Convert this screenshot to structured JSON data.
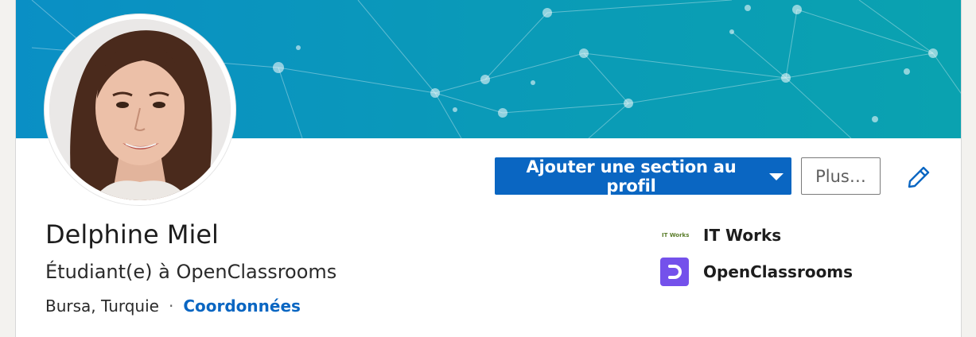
{
  "profile": {
    "name": "Delphine Miel",
    "headline": "Étudiant(e) à OpenClassrooms",
    "location": "Bursa, Turquie",
    "separator": "·",
    "contact_label": "Coordonnées"
  },
  "actions": {
    "add_section_label": "Ajouter une section au profil",
    "more_label": "Plus…"
  },
  "companies": [
    {
      "name": "IT Works",
      "logo_text": "IT Works",
      "icon": "it-works-logo"
    },
    {
      "name": "OpenClassrooms",
      "icon": "openclassrooms-logo"
    }
  ],
  "colors": {
    "primary": "#0a66c2",
    "banner": "#0a9ab8",
    "openclassrooms": "#7451eb"
  }
}
